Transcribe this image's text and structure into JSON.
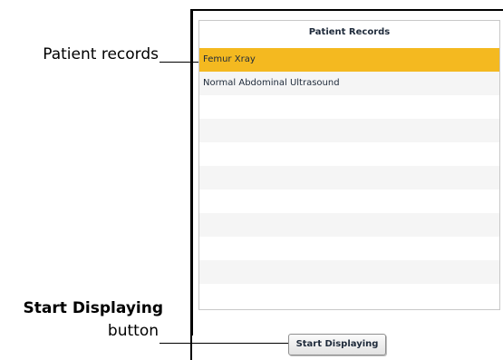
{
  "callouts": {
    "patient_records": "Patient records",
    "start_displaying_bold": "Start Displaying",
    "start_displaying_rest": "button"
  },
  "panel": {
    "header": "Patient Records",
    "items": [
      {
        "label": "Femur Xray",
        "selected": true
      },
      {
        "label": "Normal Abdominal Ultrasound",
        "selected": false
      },
      {
        "label": "",
        "selected": false
      },
      {
        "label": "",
        "selected": false
      },
      {
        "label": "",
        "selected": false
      },
      {
        "label": "",
        "selected": false
      },
      {
        "label": "",
        "selected": false
      },
      {
        "label": "",
        "selected": false
      },
      {
        "label": "",
        "selected": false
      },
      {
        "label": "",
        "selected": false
      },
      {
        "label": "",
        "selected": false
      }
    ],
    "selected_color": "#f4b920",
    "start_button_label": "Start Displaying"
  }
}
